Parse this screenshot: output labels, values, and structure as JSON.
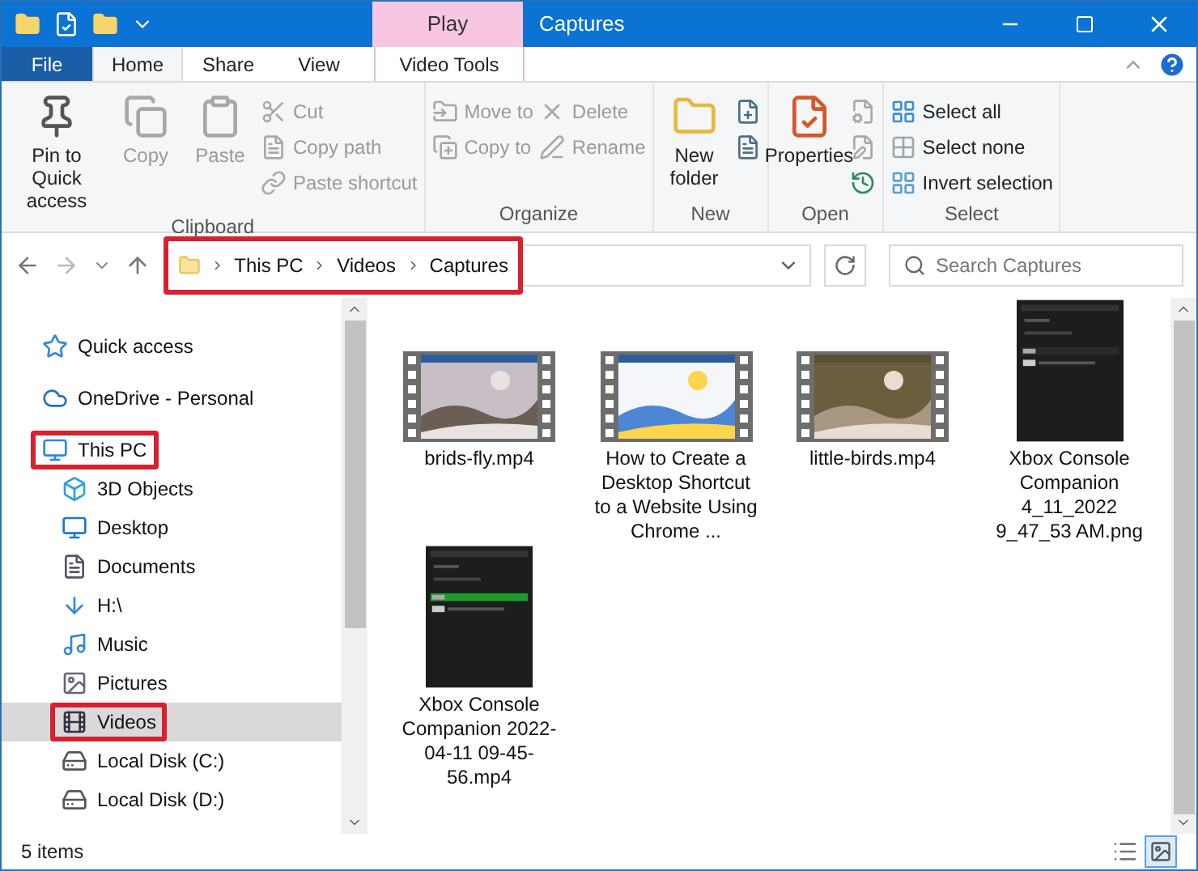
{
  "window": {
    "context_tab": "Play",
    "title": "Captures"
  },
  "ribbon_tabs": [
    {
      "label": "File",
      "kind": "file",
      "selected": false
    },
    {
      "label": "Home",
      "kind": "tab",
      "selected": true
    },
    {
      "label": "Share",
      "kind": "tab",
      "selected": false
    },
    {
      "label": "View",
      "kind": "tab",
      "selected": false
    },
    {
      "label": "Video Tools",
      "kind": "context",
      "selected": false
    }
  ],
  "ribbon_groups": [
    {
      "label": "Clipboard",
      "items": [
        {
          "label": "Pin to Quick access",
          "kind": "large",
          "disabled": false
        },
        {
          "label": "Copy",
          "kind": "large",
          "disabled": true
        },
        {
          "label": "Paste",
          "kind": "large",
          "disabled": true
        },
        {
          "kind": "stack",
          "children": [
            {
              "label": "Cut",
              "disabled": true
            },
            {
              "label": "Copy path",
              "disabled": true
            },
            {
              "label": "Paste shortcut",
              "disabled": true
            }
          ]
        }
      ]
    },
    {
      "label": "Organize",
      "items": [
        {
          "kind": "stack",
          "children": [
            {
              "label": "Move to",
              "disabled": true
            },
            {
              "label": "Copy to",
              "disabled": true
            }
          ]
        },
        {
          "kind": "stack",
          "children": [
            {
              "label": "Delete",
              "disabled": true
            },
            {
              "label": "Rename",
              "disabled": true
            }
          ]
        }
      ]
    },
    {
      "label": "New",
      "items": [
        {
          "label": "New folder",
          "kind": "large",
          "disabled": false
        },
        {
          "kind": "stack",
          "children": [
            {
              "disabled": false
            },
            {
              "disabled": false
            }
          ]
        }
      ]
    },
    {
      "label": "Open",
      "items": [
        {
          "label": "Properties",
          "kind": "large",
          "disabled": false
        },
        {
          "kind": "stack",
          "children": [
            {
              "disabled": true
            },
            {
              "disabled": true
            },
            {
              "disabled": false
            }
          ]
        }
      ]
    },
    {
      "label": "Select",
      "items": [
        {
          "kind": "stack",
          "children": [
            {
              "label": "Select all",
              "disabled": false
            },
            {
              "label": "Select none",
              "disabled": false
            },
            {
              "label": "Invert selection",
              "disabled": false
            }
          ]
        }
      ]
    }
  ],
  "address": {
    "crumbs": [
      "This PC",
      "Videos",
      "Captures"
    ],
    "highlighted": true
  },
  "search": {
    "placeholder": "Search Captures"
  },
  "nav": [
    {
      "label": "Quick access",
      "selected": false,
      "highlighted": false
    },
    {
      "label": "OneDrive - Personal",
      "selected": false,
      "highlighted": false
    },
    {
      "label": "This PC",
      "selected": false,
      "highlighted": true,
      "children": [
        {
          "label": "3D Objects",
          "selected": false,
          "highlighted": false
        },
        {
          "label": "Desktop",
          "selected": false,
          "highlighted": false
        },
        {
          "label": "Documents",
          "selected": false,
          "highlighted": false
        },
        {
          "label": "H:\\",
          "selected": false,
          "highlighted": false
        },
        {
          "label": "Music",
          "selected": false,
          "highlighted": false
        },
        {
          "label": "Pictures",
          "selected": false,
          "highlighted": false
        },
        {
          "label": "Videos",
          "selected": true,
          "highlighted": true
        },
        {
          "label": "Local Disk (C:)",
          "selected": false,
          "highlighted": false
        },
        {
          "label": "Local Disk (D:)",
          "selected": false,
          "highlighted": false
        }
      ]
    }
  ],
  "files": [
    {
      "name": "brids-fly.mp4",
      "kind": "video"
    },
    {
      "name": "How to Create a Desktop Shortcut to a Website Using Chrome ...",
      "kind": "video"
    },
    {
      "name": "little-birds.mp4",
      "kind": "video"
    },
    {
      "name": "Xbox Console Companion 4_11_2022 9_47_53 AM.png"
    },
    {
      "name": "Xbox Console Companion 2022-04-11 09-45-56.mp4"
    }
  ],
  "status_bar": {
    "count": "5 items"
  }
}
